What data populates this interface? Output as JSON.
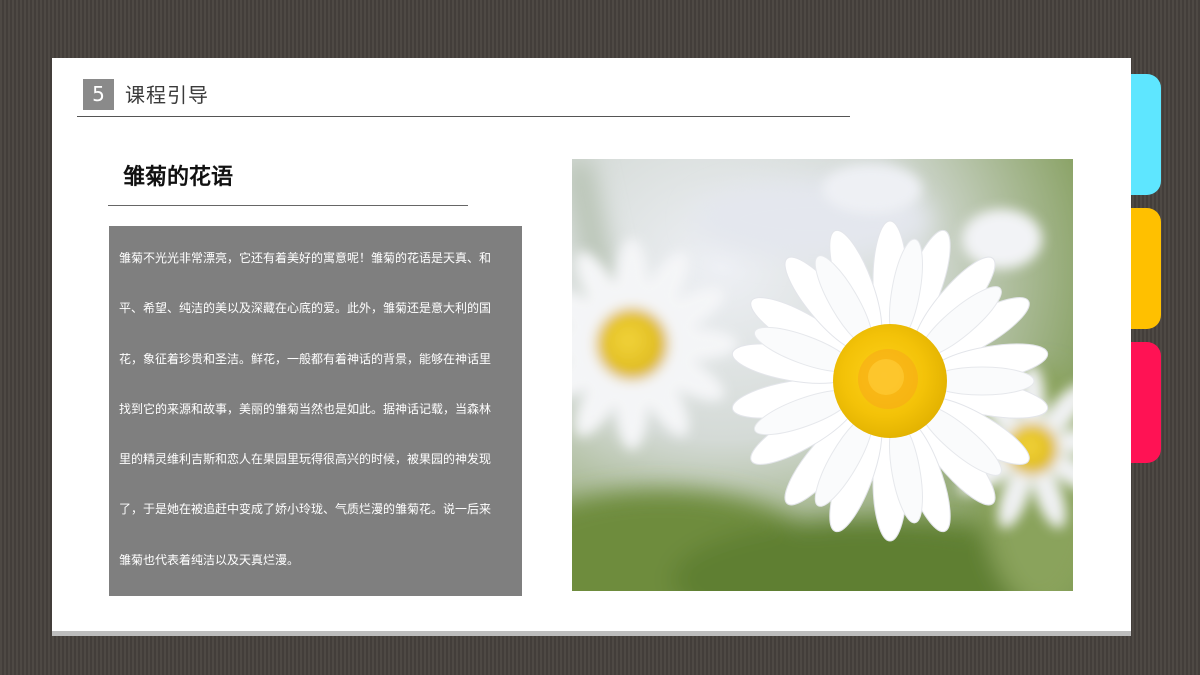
{
  "colors": {
    "tab_cyan": "#5ee6ff",
    "tab_yellow": "#ffc000",
    "tab_pink": "#ff1254",
    "text_box_bg": "#7f7f7f"
  },
  "header": {
    "number": "5",
    "title": "课程引导"
  },
  "section": {
    "title": "雏菊的花语"
  },
  "body_lines": [
    "雏菊不光光非常漂亮，它还有着美好的寓意呢！雏菊的花语是天真、和",
    "平、希望、纯洁的美以及深藏在心底的爱。此外，雏菊还是意大利的国",
    "花，象征着珍贵和圣洁。鲜花，一般都有着神话的背景，能够在神话里",
    "找到它的来源和故事，美丽的雏菊当然也是如此。据神话记载，当森林",
    "里的精灵维利吉斯和恋人在果园里玩得很高兴的时候，被果园的神发现",
    "了，于是她在被追赶中变成了娇小玲珑、气质烂漫的雏菊花。说一后来",
    "雏菊也代表着纯洁以及天真烂漫。"
  ],
  "photo": {
    "subject": "daisy-photo"
  }
}
